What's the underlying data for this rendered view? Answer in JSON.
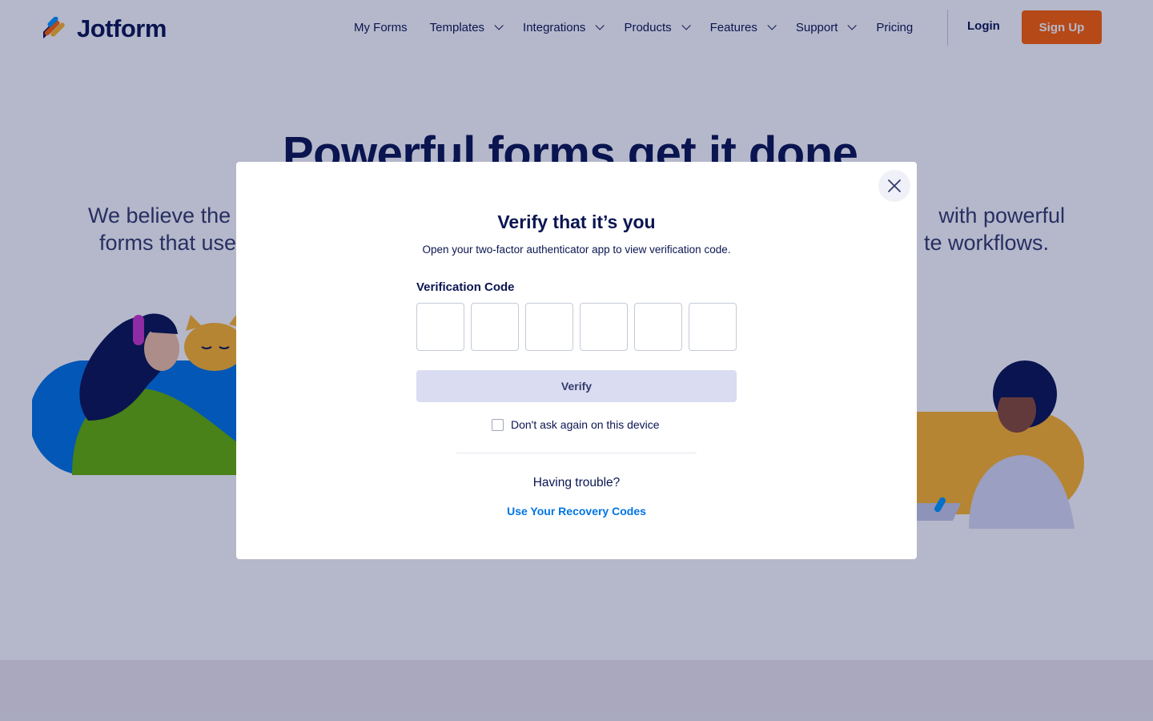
{
  "header": {
    "brand": "Jotform",
    "nav": [
      {
        "label": "My Forms",
        "has_dropdown": false
      },
      {
        "label": "Templates",
        "has_dropdown": true
      },
      {
        "label": "Integrations",
        "has_dropdown": true
      },
      {
        "label": "Products",
        "has_dropdown": true
      },
      {
        "label": "Features",
        "has_dropdown": true
      },
      {
        "label": "Support",
        "has_dropdown": true
      },
      {
        "label": "Pricing",
        "has_dropdown": false
      }
    ],
    "login_label": "Login",
    "signup_label": "Sign Up"
  },
  "hero": {
    "title": "Powerful forms get it done.",
    "subtitle_left": "We believe the",
    "subtitle_left_2": "forms that use",
    "subtitle_right": "with powerful",
    "subtitle_right_2": "te workflows."
  },
  "modal": {
    "title": "Verify that it’s you",
    "description": "Open your two-factor authenticator app to view verification code.",
    "code_label": "Verification Code",
    "code_digits": [
      "",
      "",
      "",
      "",
      "",
      ""
    ],
    "verify_label": "Verify",
    "remember_label": "Don't ask again on this device",
    "remember_checked": false,
    "trouble_text": "Having trouble?",
    "recovery_link": "Use Your Recovery Codes"
  },
  "colors": {
    "brand_navy": "#0a1551",
    "brand_orange": "#ff6100",
    "link_blue": "#0075e3",
    "verify_bg": "#dadcf2",
    "overlay": "rgba(10,21,81,0.30)"
  }
}
